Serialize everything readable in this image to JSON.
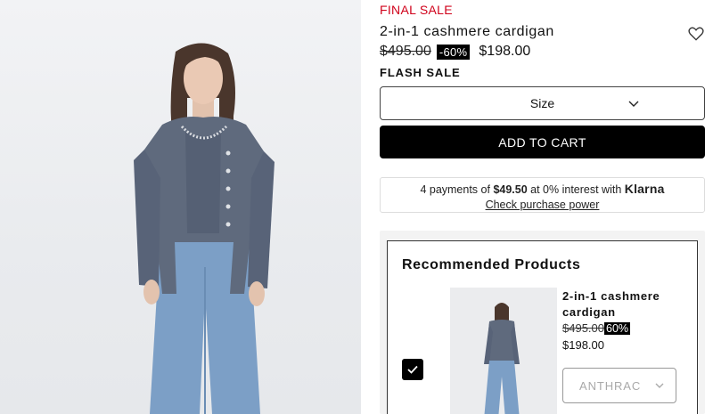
{
  "product": {
    "final_sale_label": "FINAL SALE",
    "title": "2-in-1 cashmere cardigan",
    "old_price": "$495.00",
    "discount_badge": "-60%",
    "new_price": "$198.00",
    "flash_label": "FLASH SALE",
    "wishlist_icon": "heart-outline-icon"
  },
  "size_select": {
    "label": "Size",
    "icon": "chevron-down-icon"
  },
  "add_to_cart": {
    "label": "ADD TO CART"
  },
  "klarna": {
    "prefix": "4 payments of",
    "amount": "$49.50",
    "suffix": "at 0% interest with",
    "brand": "Klarna",
    "link": "Check purchase power"
  },
  "recommended": {
    "heading": "Recommended Products",
    "item": {
      "name": "2-in-1 cashmere cardigan",
      "old_price": "$495.00",
      "discount_badge": "60%",
      "new_price": "$198.00",
      "color_value": "ANTHRAC",
      "selected": true
    }
  },
  "colors": {
    "sale_red": "#d0021b",
    "black": "#000000",
    "sweater": "#5f6a7d",
    "jeans": "#7c9fc6"
  }
}
